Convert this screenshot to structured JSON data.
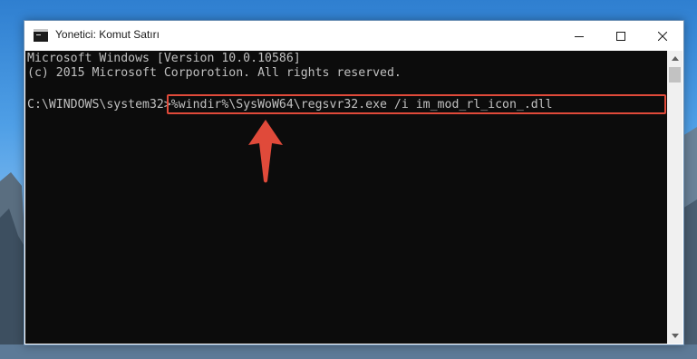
{
  "window": {
    "title": "Yonetici: Komut Satırı",
    "icon": "cmd-icon"
  },
  "controls": {
    "minimize_icon": "minimize-icon",
    "maximize_icon": "maximize-icon",
    "close_icon": "close-icon"
  },
  "console": {
    "line1": "Microsoft Windows [Version 10.0.10586]",
    "line2": "(c) 2015 Microsoft Corporotion. All rights reserved.",
    "prompt": "C:\\WINDOWS\\system32>",
    "command": "%windir%\\SysWoW64\\regsvr32.exe /i im_mod_rl_icon_.dll"
  },
  "annotation": {
    "highlight_color": "#e04a3a",
    "arrow_icon": "up-arrow-icon"
  },
  "scrollbar": {
    "up_icon": "scroll-up-arrow-icon",
    "down_icon": "scroll-down-arrow-icon"
  }
}
